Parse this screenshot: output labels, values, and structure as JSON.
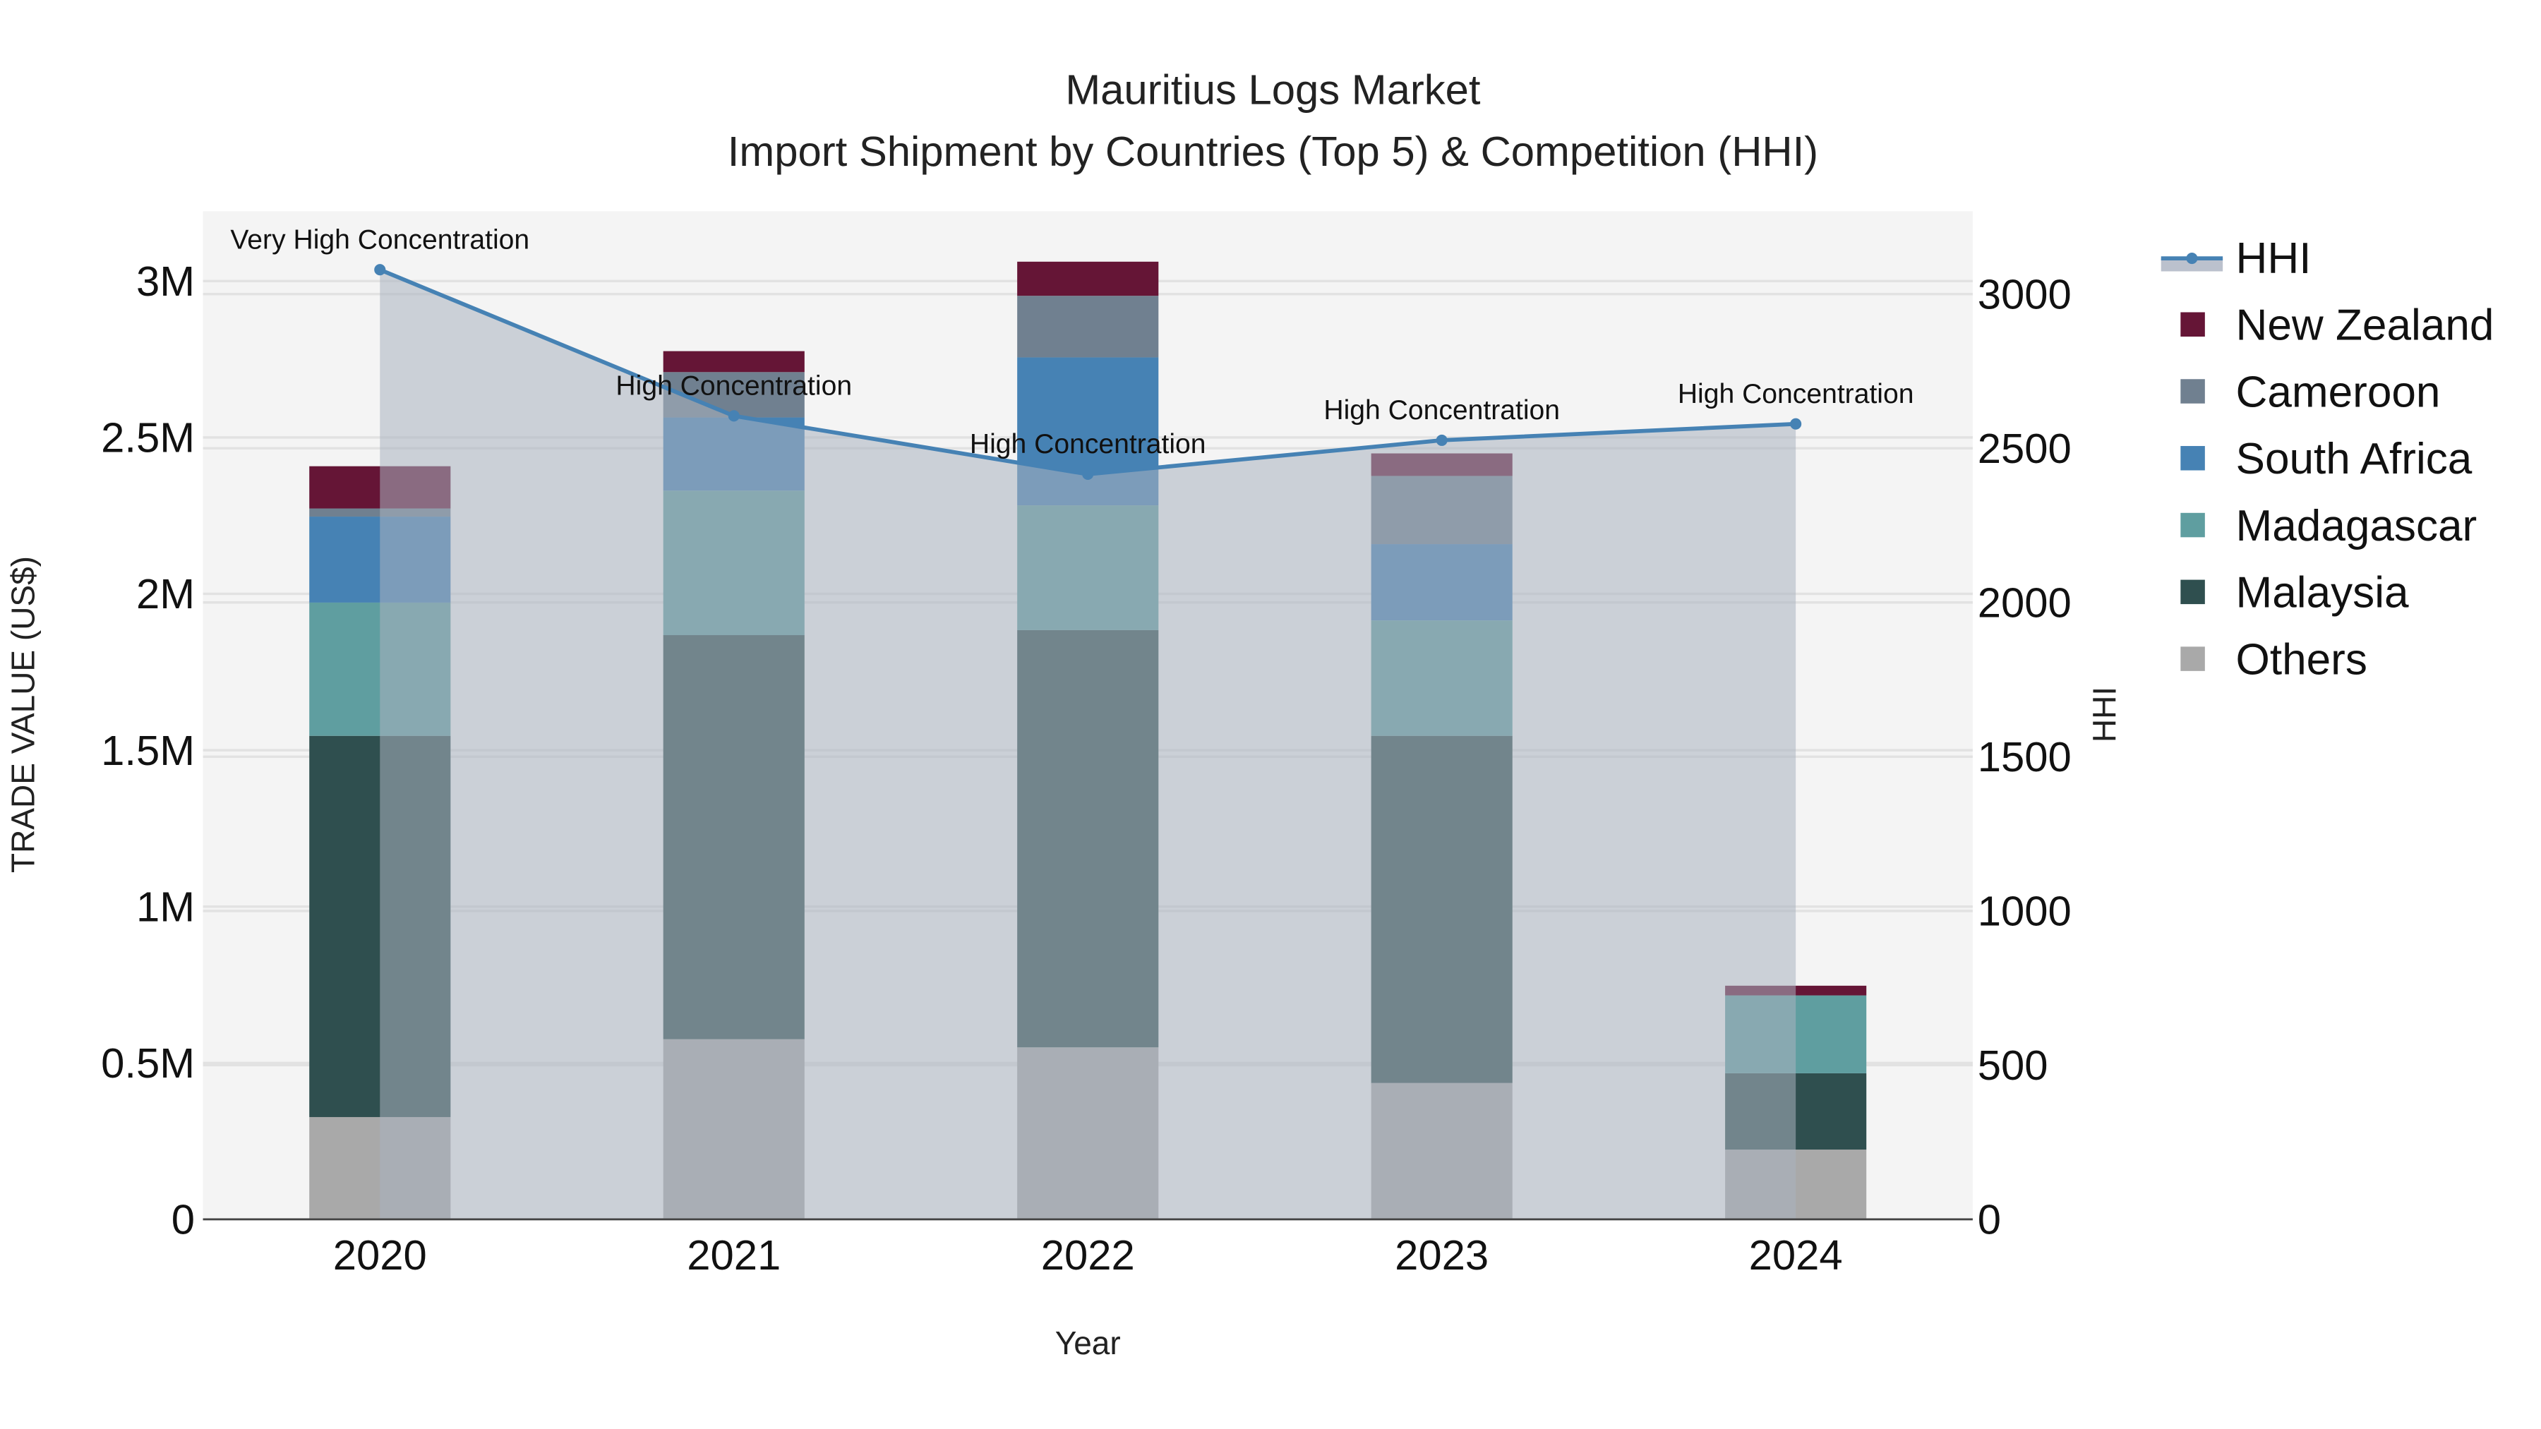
{
  "chart_data": {
    "type": "bar",
    "title": "Mauritius Logs Market",
    "subtitle": "Import Shipment by Countries (Top 5) & Competition (HHI)",
    "xlabel": "Year",
    "ylabel": "TRADE VALUE (US$)",
    "y2label": "HHI",
    "categories": [
      "2020",
      "2021",
      "2022",
      "2023",
      "2024"
    ],
    "ylim": [
      0,
      3200000
    ],
    "y2lim": [
      0,
      3270
    ],
    "yticks": [
      0,
      500000,
      1000000,
      1500000,
      2000000,
      2500000,
      3000000
    ],
    "ytick_labels": [
      "0",
      "0.5M",
      "1M",
      "1.5M",
      "2M",
      "2.5M",
      "3M"
    ],
    "y2ticks": [
      0,
      500,
      1000,
      1500,
      2000,
      2500,
      3000
    ],
    "y2tick_labels": [
      "0",
      "500",
      "1000",
      "1500",
      "2000",
      "2500",
      "3000"
    ],
    "stacked": true,
    "grid": true,
    "legend_position": "right",
    "series": [
      {
        "name": "Others",
        "color": "#A9A9A9",
        "values": [
          327000,
          576000,
          550000,
          436000,
          223000
        ]
      },
      {
        "name": "Malaysia",
        "color": "#2F4F4F",
        "values": [
          1219000,
          1292000,
          1334000,
          1110000,
          244000
        ]
      },
      {
        "name": "Madagascar",
        "color": "#5F9EA0",
        "values": [
          426000,
          462000,
          399000,
          369000,
          249000
        ]
      },
      {
        "name": "South Africa",
        "color": "#4682B4",
        "values": [
          275000,
          234000,
          473000,
          244000,
          0
        ]
      },
      {
        "name": "Cameroon",
        "color": "#708090",
        "values": [
          26000,
          145000,
          197000,
          218000,
          0
        ]
      },
      {
        "name": "New Zealand",
        "color": "#651536",
        "values": [
          135000,
          67000,
          109000,
          72000,
          31000
        ]
      }
    ],
    "line": {
      "name": "HHI",
      "color": "#4682B4",
      "axis": "right",
      "values": [
        3079,
        2605,
        2416,
        2526,
        2579
      ],
      "annotations": [
        "Very High Concentration",
        "High Concentration",
        "High Concentration",
        "High Concentration",
        "High Concentration"
      ]
    },
    "legend_order": [
      "HHI",
      "New Zealand",
      "Cameroon",
      "South Africa",
      "Madagascar",
      "Malaysia",
      "Others"
    ]
  }
}
